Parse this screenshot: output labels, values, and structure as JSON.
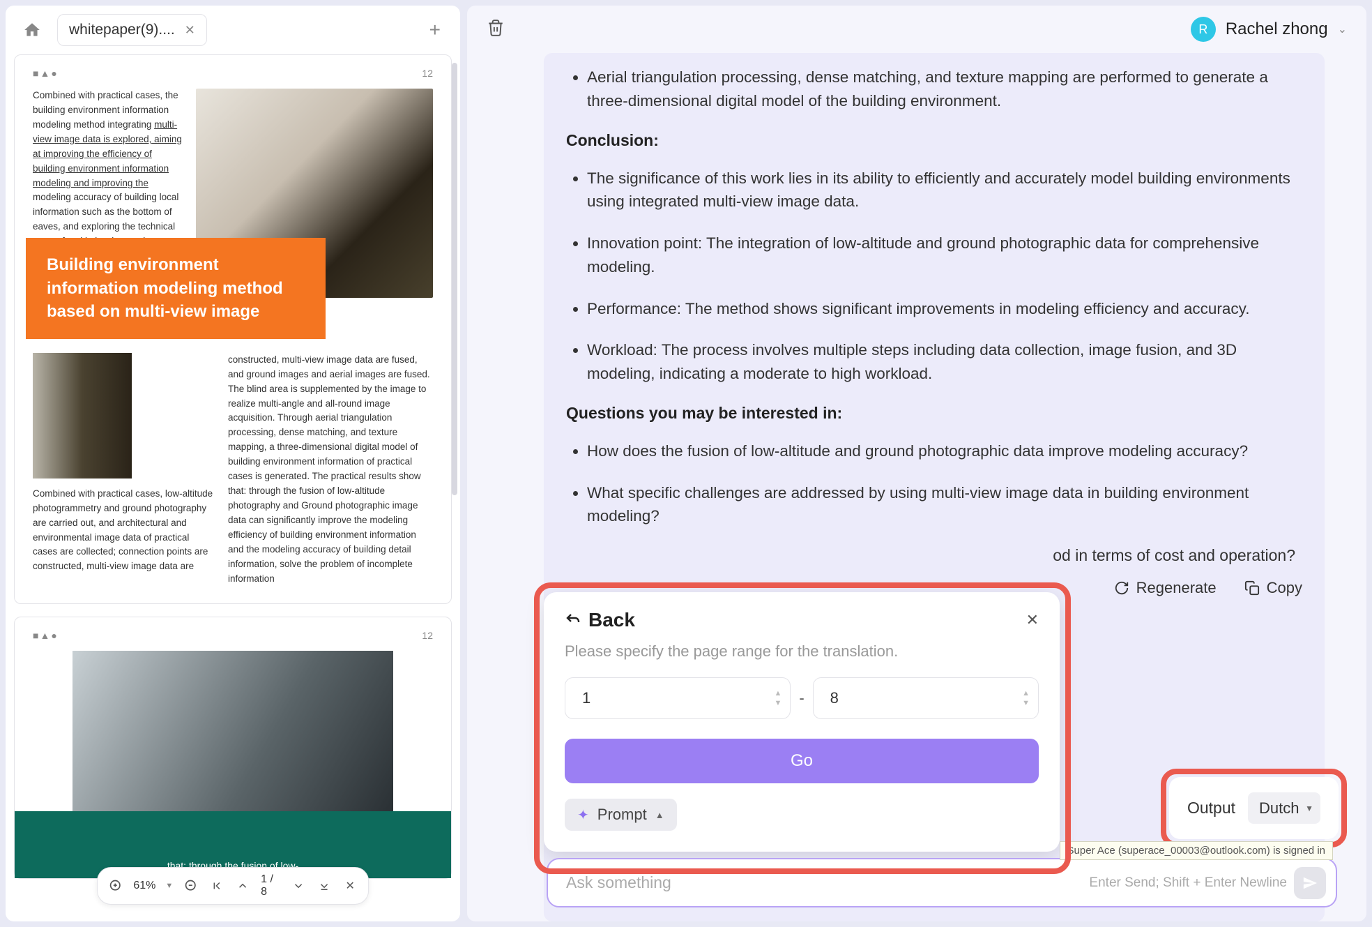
{
  "tab": {
    "label": "whitepaper(9)...."
  },
  "doc": {
    "page_num": "12",
    "text_left_1": "Combined with practical cases, the building environment information modeling method integrating ",
    "text_left_2_ul": "multi-view image data is explored, aiming at improving the efficiency of building environment information modeling and improving the",
    "text_left_3": " modeling accuracy of building local information such as the bottom of eaves, and exploring the technical route of multi-view image data fusion.",
    "orange_title": "Building environment information modeling method based on multi-view image",
    "text_right": "constructed, multi-view image data are fused, and ground images and aerial images are fused. The blind area is supplemented by the image to realize multi-angle and all-round image acquisition. Through aerial triangulation processing, dense matching, and texture mapping, a three-dimensional digital model of building environment information of practical cases is generated. The practical results show that: through the fusion of low-altitude photography and Ground photographic image data can significantly improve the modeling efficiency of building environment information and the modeling accuracy of building detail information, solve the problem of incomplete information",
    "text_bottom": "Combined with practical cases, low-altitude photogrammetry and ground photography are carried out, and architectural and environmental image data of practical cases are collected; connection points are constructed, multi-view image data are",
    "page2_num": "12",
    "page2_text": "that: through the fusion of low-"
  },
  "toolbar": {
    "zoom": "61%",
    "page_cur": "1",
    "page_total": "8"
  },
  "user": {
    "initial": "R",
    "name": "Rachel zhong"
  },
  "content": {
    "bullet1": "Aerial triangulation processing, dense matching, and texture mapping are performed to generate a three-dimensional digital model of the building environment.",
    "section_conclusion": "Conclusion:",
    "c1": "The significance of this work lies in its ability to efficiently and accurately model building environments using integrated multi-view image data.",
    "c2": "Innovation point: The integration of low-altitude and ground photographic data for comprehensive modeling.",
    "c3": "Performance: The method shows significant improvements in modeling efficiency and accuracy.",
    "c4": "Workload: The process involves multiple steps including data collection, image fusion, and 3D modeling, indicating a moderate to high workload.",
    "section_questions": "Questions you may be interested in:",
    "q1": "How does the fusion of low-altitude and ground photographic data improve modeling accuracy?",
    "q2": "What specific challenges are addressed by using multi-view image data in building environment modeling?",
    "q3_partial": "od in terms of cost and operation?",
    "regenerate": "Regenerate",
    "copy": "Copy"
  },
  "popup": {
    "back": "Back",
    "message": "Please specify the page range for the translation.",
    "from": "1",
    "to": "8",
    "go": "Go",
    "prompt": "Prompt"
  },
  "output": {
    "label": "Output",
    "lang": "Dutch"
  },
  "chat": {
    "placeholder": "Ask something",
    "hint": "Enter Send; Shift + Enter Newline"
  },
  "tooltip": "Super Ace (superace_00003@outlook.com) is signed in"
}
